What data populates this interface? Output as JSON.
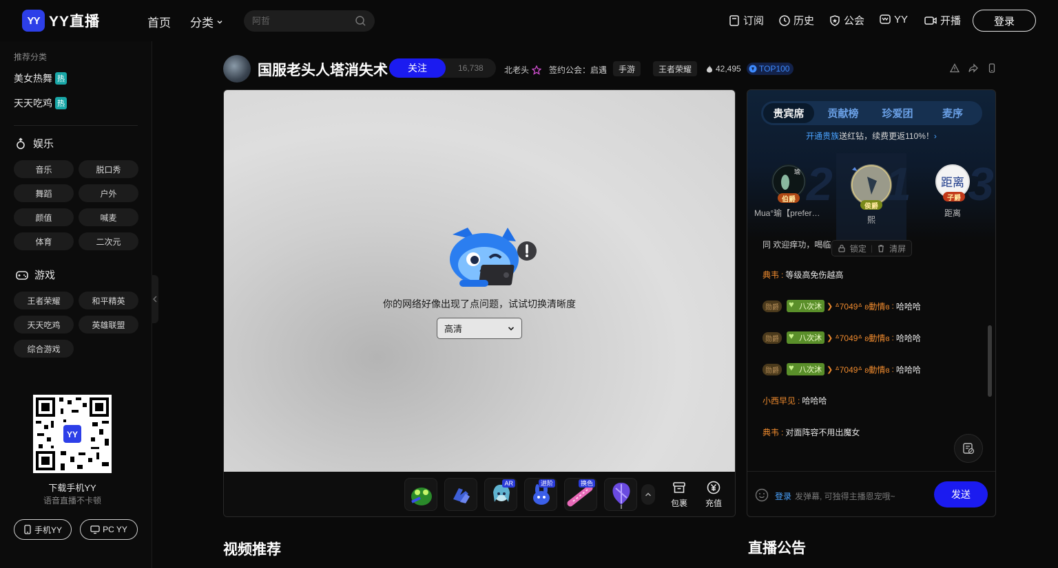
{
  "logo": {
    "badge": "YY",
    "text": "YY直播"
  },
  "nav": {
    "home": "首页",
    "category": "分类"
  },
  "search": {
    "placeholder": "阿哲"
  },
  "topright": {
    "subscribe": "订阅",
    "history": "历史",
    "guild": "公会",
    "yy": "YY",
    "broadcast": "开播",
    "login": "登录"
  },
  "sidebar": {
    "recommend_label": "推荐分类",
    "hot_items": [
      {
        "label": "美女热舞",
        "badge": "热"
      },
      {
        "label": "天天吃鸡",
        "badge": "热"
      }
    ],
    "entertainment": {
      "title": "娱乐",
      "chips": [
        "音乐",
        "脱口秀",
        "舞蹈",
        "户外",
        "颜值",
        "喊麦",
        "体育",
        "二次元"
      ]
    },
    "games": {
      "title": "游戏",
      "chips": [
        "王者荣耀",
        "和平精英",
        "天天吃鸡",
        "英雄联盟",
        "综合游戏"
      ]
    },
    "qr": {
      "title": "下载手机YY",
      "subtitle": "语音直播不卡顿",
      "badge": "YY"
    },
    "download": {
      "mobile": "手机YY",
      "pc": "PC YY"
    }
  },
  "room": {
    "title": "国服老头人塔消失术",
    "follow": "关注",
    "followers": "16,738",
    "anchor": "北老头",
    "guild": "签约公会：启遇",
    "tags": [
      "手游",
      "王者荣耀"
    ],
    "heat": "42,495",
    "rank": "TOP100"
  },
  "player": {
    "error": "你的网络好像出现了点问题，试试切换清晰度",
    "quality": "高清",
    "gift_badges": [
      "AR",
      "进阶",
      "换色"
    ],
    "bag": "包裹",
    "recharge": "充值"
  },
  "panel": {
    "tabs": [
      "贵宾席",
      "贡献榜",
      "珍爱团",
      "麦序"
    ],
    "noble_link": "开通贵族",
    "noble_text": "送红钻，续费更返110%！",
    "ranks": [
      {
        "num": "2",
        "name": "Mua°瑜【prefere…",
        "badge": "伯爵",
        "avatar_text": "瑜"
      },
      {
        "num": "1",
        "name": "熙",
        "badge": "侯爵",
        "avatar_text": ""
      },
      {
        "num": "3",
        "name": "距离",
        "badge": "子爵",
        "avatar_text": "距离"
      }
    ],
    "lock": "锁定",
    "clear": "清屏",
    "chat_partial": "同 欢迎痒功，喝临",
    "chat": [
      {
        "nick": "典韦",
        "msg": "等级高免伤越高"
      },
      {
        "level": "勋爵",
        "fan": "八次沐",
        "fanlvl": "10",
        "nick": "ᐞ7049ᐞ ʚ動情ɞ",
        "msg": "哈哈哈"
      },
      {
        "level": "勋爵",
        "fan": "八次沐",
        "fanlvl": "10",
        "nick": "ᐞ7049ᐞ ʚ動情ɞ",
        "msg": "哈哈哈"
      },
      {
        "level": "勋爵",
        "fan": "八次沐",
        "fanlvl": "10",
        "nick": "ᐞ7049ᐞ ʚ動情ɞ",
        "msg": "哈哈哈"
      },
      {
        "nick": "小西早见",
        "msg": "哈哈哈"
      },
      {
        "nick": "典韦",
        "msg": "对面阵容不用出魔女"
      }
    ],
    "input_login": "登录",
    "input_placeholder": "发弹幕, 可独得主播恩宠哦~",
    "send": "发送"
  },
  "sections": {
    "video": "视频推荐",
    "notice": "直播公告"
  }
}
